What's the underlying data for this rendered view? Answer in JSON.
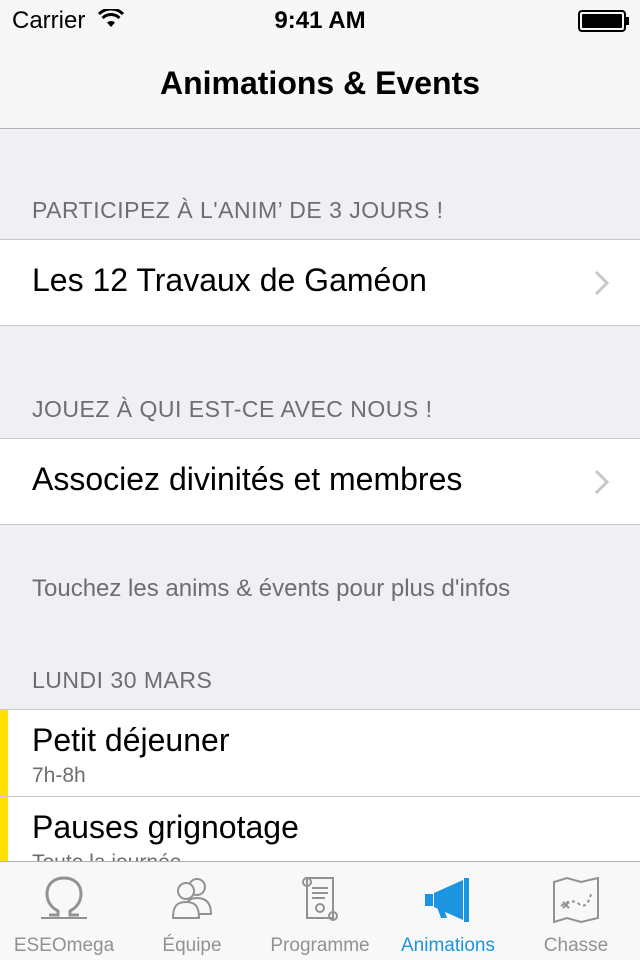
{
  "status_bar": {
    "carrier": "Carrier",
    "time": "9:41 AM"
  },
  "nav": {
    "title": "Animations & Events"
  },
  "sections": [
    {
      "header": "PARTICIPEZ À L'ANIM’ DE 3 JOURS !",
      "cell_label": "Les 12 Travaux de Gaméon"
    },
    {
      "header": "JOUEZ À QUI EST-CE AVEC NOUS !",
      "cell_label": "Associez divinités et membres"
    }
  ],
  "info_note": "Touchez les anims & évents pour plus d'infos",
  "day": {
    "header": "LUNDI 30 MARS",
    "events": [
      {
        "title": "Petit déjeuner",
        "time": "7h-8h",
        "accent_color": "#ffe000"
      },
      {
        "title": "Pauses grignotage",
        "time": "Toute la journée",
        "accent_color": "#ffe000"
      }
    ]
  },
  "tabs": [
    {
      "label": "ESEOmega",
      "icon": "omega-icon",
      "active": false
    },
    {
      "label": "Équipe",
      "icon": "people-icon",
      "active": false
    },
    {
      "label": "Programme",
      "icon": "scroll-icon",
      "active": false
    },
    {
      "label": "Animations",
      "icon": "megaphone-icon",
      "active": true
    },
    {
      "label": "Chasse",
      "icon": "treasure-map-icon",
      "active": false
    }
  ],
  "colors": {
    "accent": "#1b95e0",
    "event_accent": "#ffe000",
    "inactive_tab": "#929292"
  }
}
